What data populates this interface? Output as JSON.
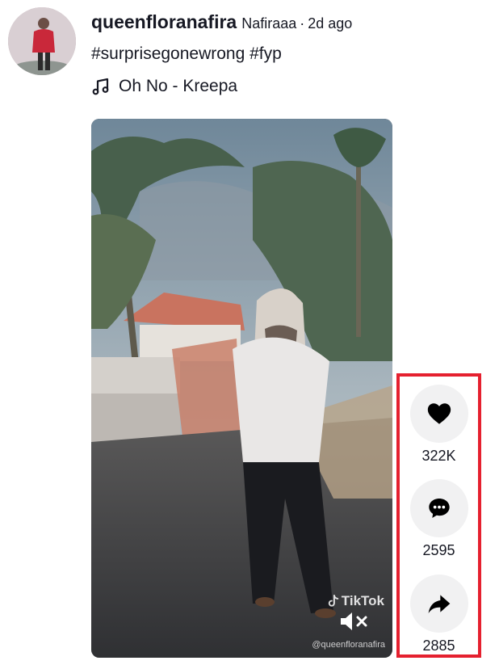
{
  "post": {
    "username": "queenfloranafira",
    "nickname": "Nafiraaa",
    "separator": "·",
    "time_ago": "2d ago",
    "caption": "#surprisegonewrong #fyp",
    "music": "Oh No - Kreepa"
  },
  "video": {
    "watermark": "TikTok",
    "handle": "@queenfloranafira"
  },
  "actions": {
    "like_count": "322K",
    "comment_count": "2595",
    "share_count": "2885"
  },
  "colors": {
    "highlight_border": "#e5202f",
    "action_bg": "#f1f1f2",
    "text": "#161823"
  }
}
